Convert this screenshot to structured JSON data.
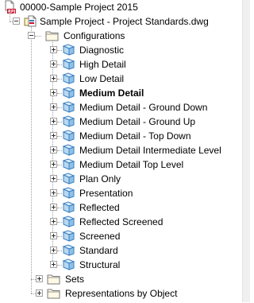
{
  "tree": {
    "root": {
      "label": "00000-Sample Project 2015",
      "icon": "project-document-icon",
      "icon_badge": "RPJ"
    },
    "drawing": {
      "label": "Sample Project - Project Standards.dwg",
      "icon": "drawing-file-icon"
    },
    "configurations": {
      "label": "Configurations",
      "icon": "folder-icon",
      "items": [
        {
          "label": "Diagnostic",
          "bold": false
        },
        {
          "label": "High Detail",
          "bold": false
        },
        {
          "label": "Low Detail",
          "bold": false
        },
        {
          "label": "Medium Detail",
          "bold": true
        },
        {
          "label": "Medium Detail - Ground Down",
          "bold": false
        },
        {
          "label": "Medium Detail - Ground Up",
          "bold": false
        },
        {
          "label": "Medium Detail - Top Down",
          "bold": false
        },
        {
          "label": "Medium Detail Intermediate Level",
          "bold": false
        },
        {
          "label": "Medium Detail Top Level",
          "bold": false
        },
        {
          "label": "Plan Only",
          "bold": false
        },
        {
          "label": "Presentation",
          "bold": false
        },
        {
          "label": "Reflected",
          "bold": false
        },
        {
          "label": "Reflected Screened",
          "bold": false
        },
        {
          "label": "Screened",
          "bold": false
        },
        {
          "label": "Standard",
          "bold": false
        },
        {
          "label": "Structural",
          "bold": false
        }
      ]
    },
    "sets": {
      "label": "Sets",
      "icon": "folder-icon"
    },
    "representations": {
      "label": "Representations by Object",
      "icon": "folder-icon"
    }
  },
  "colors": {
    "folder_fill": "#fff9e6",
    "folder_stroke": "#7a7a7a",
    "config_fill": "#b8d9f2",
    "config_stroke": "#3b7fc0",
    "tree_line": "#a0a0a0",
    "badge_red": "#c8102e"
  }
}
